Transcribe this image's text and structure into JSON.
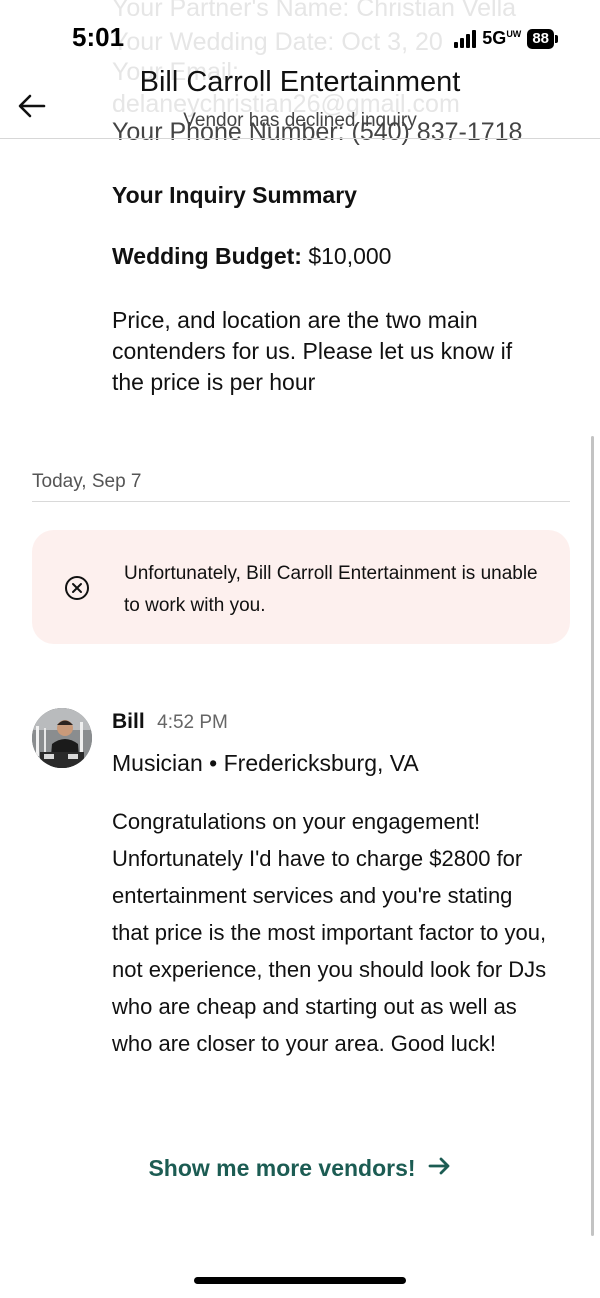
{
  "status_bar": {
    "time": "5:01",
    "network": "5G",
    "network_superscript": "UW",
    "battery": "88"
  },
  "background_form": {
    "partner_line": "Your Partner's Name: Christian Vella",
    "wedding_date_line": "Your Wedding Date: Oct 3, 20",
    "email_label": "Your Email:",
    "email_value": "delaneychristian26@gmail.com",
    "phone_line": "Your Phone Number: (540) 837-1718"
  },
  "header": {
    "title": "Bill Carroll Entertainment",
    "subtitle": "Vendor has declined inquiry"
  },
  "inquiry": {
    "summary_heading": "Your Inquiry Summary",
    "budget_label": "Wedding Budget:",
    "budget_value": "$10,000",
    "message": "Price, and location are the two main contenders for us. Please let us know if the price is per hour"
  },
  "timeline": {
    "date_label": "Today, Sep 7"
  },
  "decline_notice": {
    "text": "Unfortunately, Bill Carroll Entertainment is unable to work with you."
  },
  "vendor_message": {
    "sender": "Bill",
    "time": "4:52 PM",
    "role": "Musician",
    "separator": "•",
    "location": "Fredericksburg, VA",
    "body": "Congratulations on your engagement! Unfortunately I'd have to charge $2800 for entertainment services and you're stating that price is the most important factor to you, not experience, then you should look for DJs who are cheap and starting out as well as who are closer to your area. Good luck!"
  },
  "actions": {
    "more_vendors_label": "Show me more vendors!"
  },
  "icons": {
    "back": "arrow-left-icon",
    "decline": "x-circle-icon",
    "more_vendors": "arrow-right-icon"
  },
  "colors": {
    "accent": "#1c5c53",
    "decline_background": "#fdf0ee"
  }
}
